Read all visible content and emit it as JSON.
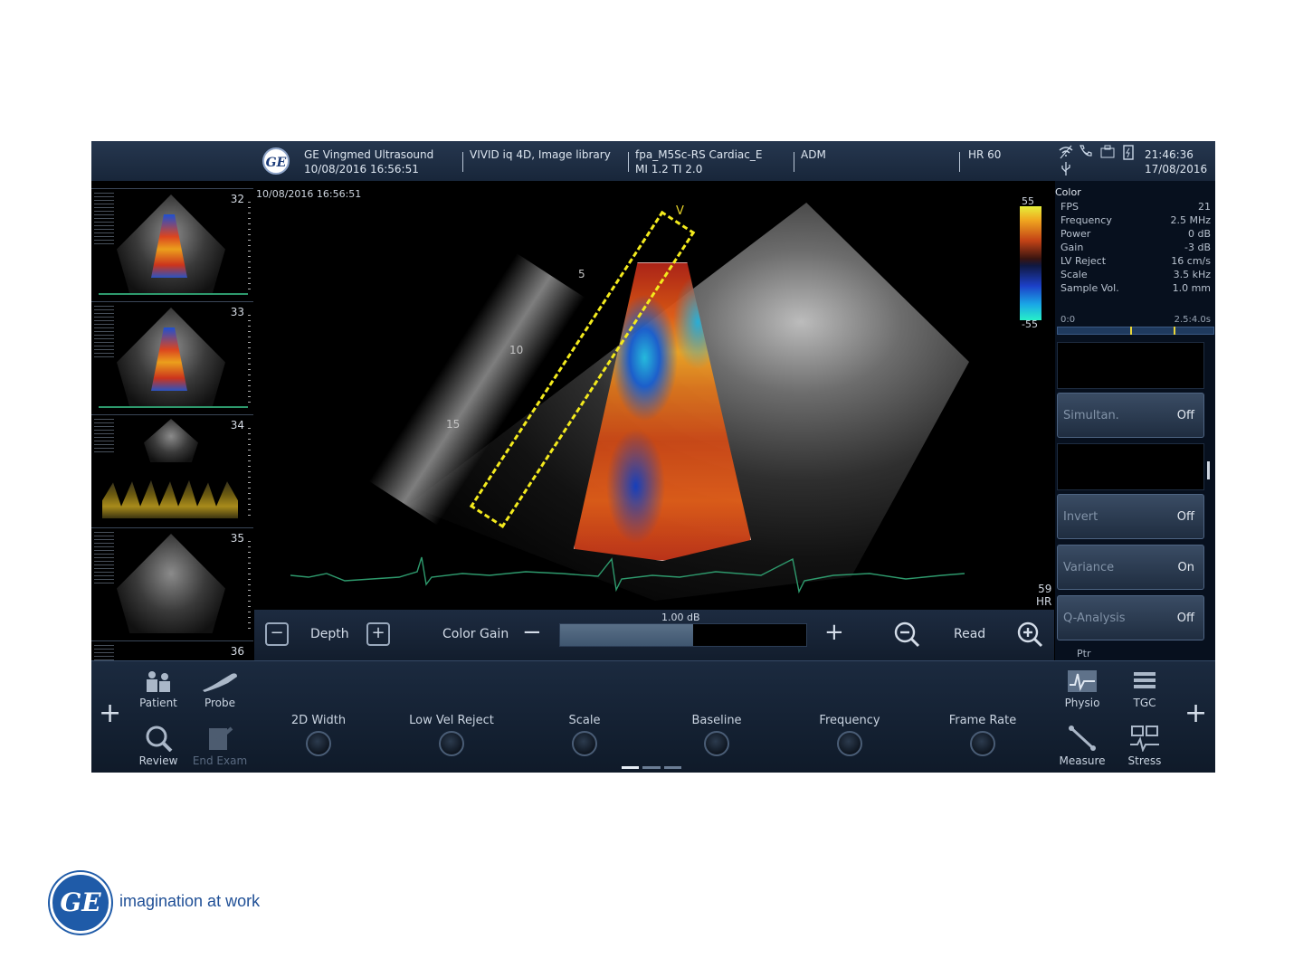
{
  "header": {
    "logo_text": "GE",
    "vendor": "GE Vingmed Ultrasound",
    "exam_datetime": "10/08/2016 16:56:51",
    "system": "VIVID iq 4D, Image library",
    "probe_preset": "fpa_M5Sc-RS  Cardiac_E",
    "mi_ti": "MI 1.2  TI 2.0",
    "operator": "ADM",
    "hr": "HR 60",
    "clock_time": "21:46:36",
    "clock_date": "17/08/2016",
    "icons": [
      "wireless-icon",
      "phone-icon",
      "network-icon",
      "battery-icon",
      "usb-icon"
    ]
  },
  "thumbnails": [
    {
      "number": "32",
      "kind": "color"
    },
    {
      "number": "33",
      "kind": "color"
    },
    {
      "number": "34",
      "kind": "doppler"
    },
    {
      "number": "35",
      "kind": "bmode"
    },
    {
      "number": "36",
      "kind": "bmode"
    }
  ],
  "image": {
    "timestamp": "10/08/2016 16:56:51",
    "v_marker": "V",
    "depth_markers": [
      "5",
      "10",
      "15"
    ],
    "colorbar_max": "55",
    "colorbar_min": "-55",
    "hr_value": "59",
    "hr_label": "HR",
    "colors": {
      "highlight": "#f3ea1d",
      "ecg": "#2e9a6d"
    }
  },
  "params": {
    "title": "Color",
    "rows": [
      {
        "label": "FPS",
        "value": "21"
      },
      {
        "label": "Frequency",
        "value": "2.5 MHz"
      },
      {
        "label": "Power",
        "value": "0 dB"
      },
      {
        "label": "Gain",
        "value": "-3 dB"
      },
      {
        "label": "LV Reject",
        "value": "16 cm/s"
      },
      {
        "label": "Scale",
        "value": "3.5 kHz"
      },
      {
        "label": "Sample Vol.",
        "value": "1.0 mm"
      }
    ],
    "timeline_start": "0:0",
    "timeline_end": "2.5:4.0s",
    "soft_buttons": {
      "simultan": {
        "label": "Simultan.",
        "value": "Off"
      },
      "invert": {
        "label": "Invert",
        "value": "Off"
      },
      "variance": {
        "label": "Variance",
        "value": "On"
      },
      "q_analysis": {
        "label": "Q-Analysis",
        "value": "Off"
      }
    },
    "ptr_label": "Ptr"
  },
  "gainbar": {
    "depth_label": "Depth",
    "minus": "−",
    "plus": "+",
    "color_gain_label": "Color Gain",
    "gain_value": "1.00 dB",
    "gain_fraction": 0.54,
    "read_label": "Read"
  },
  "bottom": {
    "plus": "+",
    "tiles_left": [
      {
        "label": "Patient",
        "icon": "patient-icon"
      },
      {
        "label": "Probe",
        "icon": "probe-icon"
      },
      {
        "label": "Review",
        "icon": "review-icon"
      },
      {
        "label": "End Exam",
        "icon": "end-exam-icon"
      }
    ],
    "knobs": [
      "2D Width",
      "Low Vel Reject",
      "Scale",
      "Baseline",
      "Frequency",
      "Frame Rate"
    ],
    "tiles_right": [
      {
        "label": "Physio",
        "icon": "physio-icon"
      },
      {
        "label": "TGC",
        "icon": "tgc-icon"
      },
      {
        "label": "Measure",
        "icon": "measure-icon"
      },
      {
        "label": "Stress",
        "icon": "stress-icon"
      }
    ]
  },
  "footer": {
    "logo_text": "GE",
    "tagline": "imagination at work"
  }
}
